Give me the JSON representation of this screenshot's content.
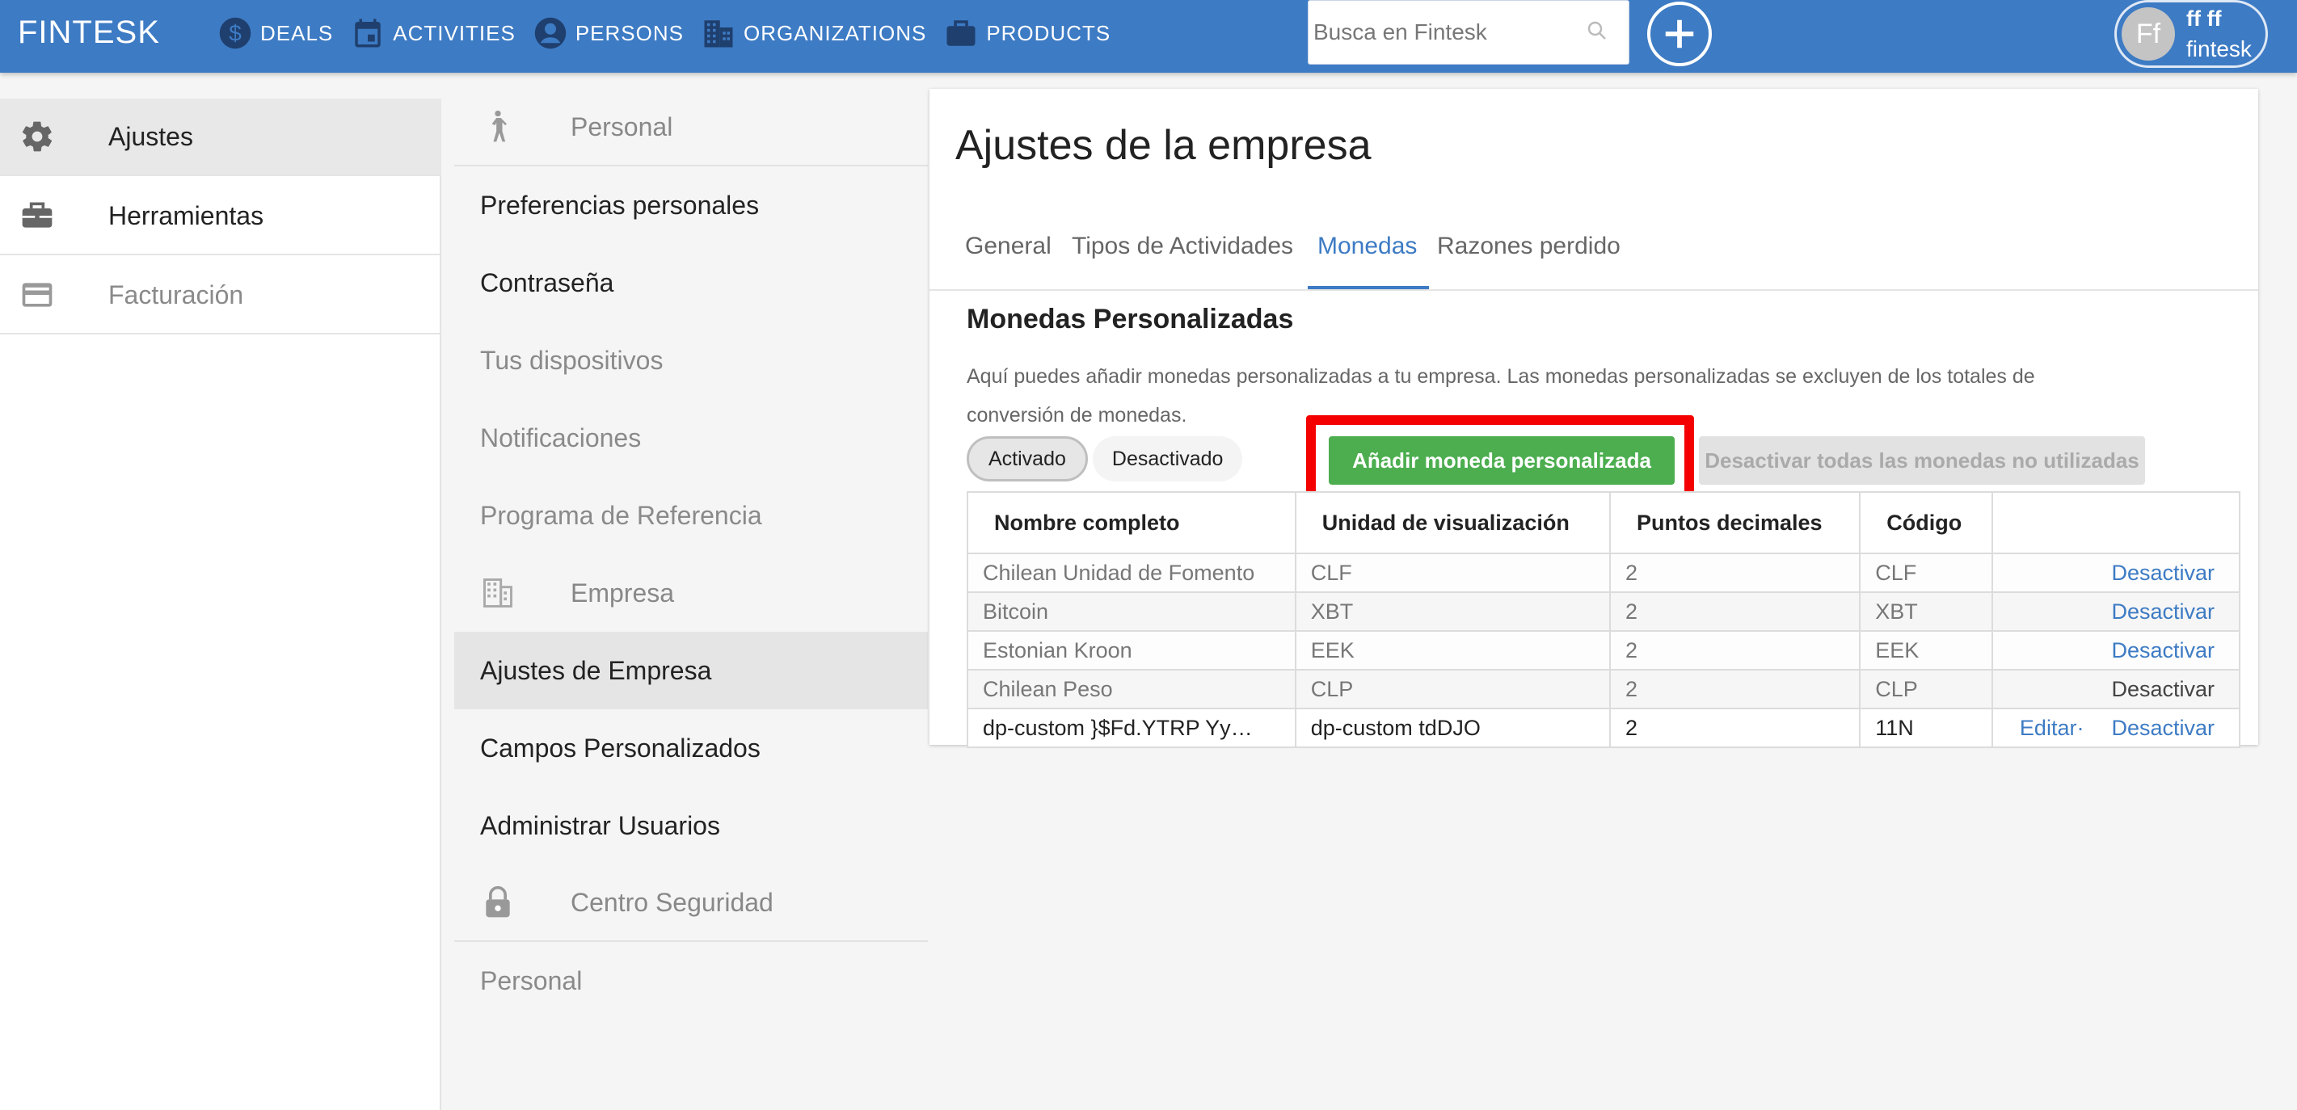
{
  "header": {
    "brand": "FINTESK",
    "nav": [
      {
        "label": "DEALS",
        "icon": "dollar-circle-icon"
      },
      {
        "label": "ACTIVITIES",
        "icon": "calendar-icon"
      },
      {
        "label": "PERSONS",
        "icon": "person-circle-icon"
      },
      {
        "label": "ORGANIZATIONS",
        "icon": "building-icon"
      },
      {
        "label": "PRODUCTS",
        "icon": "briefcase-icon"
      }
    ],
    "search_placeholder": "Busca en Fintesk",
    "user": {
      "initials": "Ff",
      "name": "ff ff",
      "org": "fintesk"
    }
  },
  "sidebar": {
    "items": [
      {
        "label": "Ajustes",
        "icon": "gear-icon"
      },
      {
        "label": "Herramientas",
        "icon": "toolbox-icon"
      },
      {
        "label": "Facturación",
        "icon": "credit-card-icon"
      }
    ]
  },
  "submenu": {
    "personal_header": "Personal",
    "personal_items": [
      "Preferencias personales",
      "Contraseña",
      "Tus dispositivos",
      "Notificaciones",
      "Programa de Referencia"
    ],
    "company_header": "Empresa",
    "company_items": [
      "Ajustes de Empresa",
      "Campos Personalizados",
      "Administrar Usuarios"
    ],
    "security_header": "Centro Seguridad",
    "security_items": [
      "Personal"
    ]
  },
  "main": {
    "title": "Ajustes de la empresa",
    "tabs": [
      "General",
      "Tipos de Actividades",
      "Monedas",
      "Razones perdido"
    ],
    "active_tab": "Monedas",
    "section_title": "Monedas Personalizadas",
    "section_desc": "Aquí puedes añadir monedas personalizadas a tu empresa. Las monedas personalizadas se excluyen de los totales de conversión de monedas.",
    "filter": {
      "on": "Activado",
      "off": "Desactivado"
    },
    "add_button": "Añadir moneda personalizada",
    "deactivate_all_button": "Desactivar todas las monedas no utilizadas",
    "table": {
      "headers": [
        "Nombre completo",
        "Unidad de visualización",
        "Puntos decimales",
        "Código",
        ""
      ],
      "rows": [
        {
          "name": "Chilean Unidad de Fomento",
          "unit": "CLF",
          "decimals": "2",
          "code": "CLF",
          "action": "Desactivar"
        },
        {
          "name": "Bitcoin",
          "unit": "XBT",
          "decimals": "2",
          "code": "XBT",
          "action": "Desactivar"
        },
        {
          "name": "Estonian Kroon",
          "unit": "EEK",
          "decimals": "2",
          "code": "EEK",
          "action": "Desactivar"
        },
        {
          "name": "Chilean Peso",
          "unit": "CLP",
          "decimals": "2",
          "code": "CLP",
          "action": "Desactivar"
        },
        {
          "name": "dp-custom }$Fd.YTRP Yy…",
          "unit": "dp-custom tdDJO",
          "decimals": "2",
          "code": "11N",
          "edit": "Editar·",
          "action": "Desactivar"
        }
      ]
    }
  },
  "colors": {
    "topbar": "#3d7bc4",
    "accent": "#3d7bc4",
    "success": "#4cae4f",
    "highlight": "#f40000"
  }
}
